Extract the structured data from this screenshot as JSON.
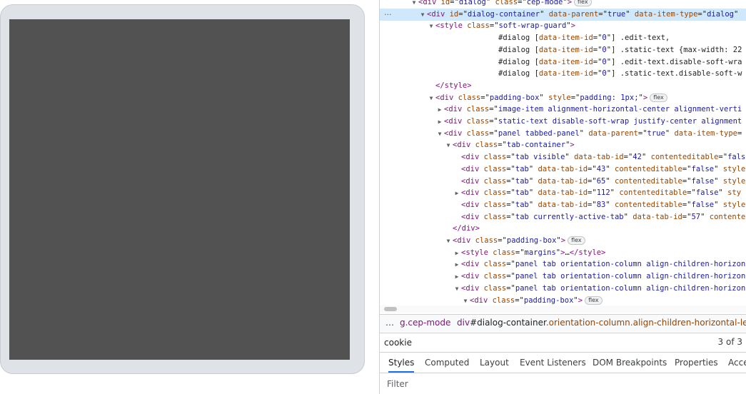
{
  "dom": {
    "rows": [
      {
        "indent": 2,
        "tri": "▼",
        "parts": [
          [
            "tag",
            "<div "
          ],
          [
            "an",
            "id"
          ],
          [
            "eq",
            "=\""
          ],
          [
            "av",
            "dialog"
          ],
          [
            "eq",
            "\" "
          ],
          [
            "an",
            "class"
          ],
          [
            "eq",
            "=\""
          ],
          [
            "av",
            "cep-mode"
          ],
          [
            "eq",
            "\""
          ],
          [
            "tag",
            ">"
          ]
        ],
        "badge": "flex",
        "selected": false
      },
      {
        "indent": 3,
        "tri": "▼",
        "parts": [
          [
            "tag",
            "<div "
          ],
          [
            "an",
            "id"
          ],
          [
            "eq",
            "=\""
          ],
          [
            "av",
            "dialog-container"
          ],
          [
            "eq",
            "\" "
          ],
          [
            "an",
            "data-parent"
          ],
          [
            "eq",
            "=\""
          ],
          [
            "av",
            "true"
          ],
          [
            "eq",
            "\" "
          ],
          [
            "an",
            "data-item-type"
          ],
          [
            "eq",
            "=\""
          ],
          [
            "av",
            "dialog"
          ],
          [
            "eq",
            "\""
          ]
        ],
        "selected": true
      },
      {
        "indent": 4,
        "tri": "▼",
        "parts": [
          [
            "tag",
            "<style "
          ],
          [
            "an",
            "class"
          ],
          [
            "eq",
            "=\""
          ],
          [
            "av",
            "soft-wrap-guard"
          ],
          [
            "eq",
            "\""
          ],
          [
            "tag",
            ">"
          ]
        ]
      },
      {
        "indent": 0,
        "pad": 154,
        "parts": [
          [
            "tx",
            "#dialog ["
          ],
          [
            "an",
            "data-item-id"
          ],
          [
            "eq",
            "=\""
          ],
          [
            "av",
            "0"
          ],
          [
            "eq",
            "\"] "
          ],
          [
            "tx",
            ".edit-text,"
          ]
        ]
      },
      {
        "indent": 0,
        "pad": 154,
        "parts": [
          [
            "tx",
            "#dialog ["
          ],
          [
            "an",
            "data-item-id"
          ],
          [
            "eq",
            "=\""
          ],
          [
            "av",
            "0"
          ],
          [
            "eq",
            "\"] "
          ],
          [
            "tx",
            ".static-text {max-width: 22"
          ]
        ]
      },
      {
        "indent": 0,
        "pad": 154,
        "parts": [
          [
            "tx",
            "#dialog ["
          ],
          [
            "an",
            "data-item-id"
          ],
          [
            "eq",
            "=\""
          ],
          [
            "av",
            "0"
          ],
          [
            "eq",
            "\"] "
          ],
          [
            "tx",
            ".edit-text.disable-soft-wra"
          ]
        ]
      },
      {
        "indent": 0,
        "pad": 154,
        "parts": [
          [
            "tx",
            "#dialog ["
          ],
          [
            "an",
            "data-item-id"
          ],
          [
            "eq",
            "=\""
          ],
          [
            "av",
            "0"
          ],
          [
            "eq",
            "\"] "
          ],
          [
            "tx",
            ".static-text.disable-soft-w"
          ]
        ]
      },
      {
        "indent": 4,
        "parts": [
          [
            "tag",
            "</style>"
          ]
        ]
      },
      {
        "indent": 4,
        "tri": "▼",
        "parts": [
          [
            "tag",
            "<div "
          ],
          [
            "an",
            "class"
          ],
          [
            "eq",
            "=\""
          ],
          [
            "av",
            "padding-box"
          ],
          [
            "eq",
            "\" "
          ],
          [
            "an",
            "style"
          ],
          [
            "eq",
            "=\""
          ],
          [
            "av",
            "padding: 1px;"
          ],
          [
            "eq",
            "\""
          ],
          [
            "tag",
            ">"
          ]
        ],
        "badge": "flex"
      },
      {
        "indent": 5,
        "tri": "▶",
        "parts": [
          [
            "tag",
            "<div "
          ],
          [
            "an",
            "class"
          ],
          [
            "eq",
            "=\""
          ],
          [
            "av",
            "image-item alignment-horizontal-center alignment-verti"
          ]
        ]
      },
      {
        "indent": 5,
        "tri": "▶",
        "parts": [
          [
            "tag",
            "<div "
          ],
          [
            "an",
            "class"
          ],
          [
            "eq",
            "=\""
          ],
          [
            "av",
            "static-text disable-soft-wrap justify-center alignment"
          ]
        ]
      },
      {
        "indent": 5,
        "tri": "▼",
        "parts": [
          [
            "tag",
            "<div "
          ],
          [
            "an",
            "class"
          ],
          [
            "eq",
            "=\""
          ],
          [
            "av",
            "panel tabbed-panel"
          ],
          [
            "eq",
            "\" "
          ],
          [
            "an",
            "data-parent"
          ],
          [
            "eq",
            "=\""
          ],
          [
            "av",
            "true"
          ],
          [
            "eq",
            "\" "
          ],
          [
            "an",
            "data-item-type"
          ],
          [
            "eq",
            "="
          ]
        ]
      },
      {
        "indent": 6,
        "tri": "▼",
        "parts": [
          [
            "tag",
            "<div "
          ],
          [
            "an",
            "class"
          ],
          [
            "eq",
            "=\""
          ],
          [
            "av",
            "tab-container"
          ],
          [
            "eq",
            "\""
          ],
          [
            "tag",
            ">"
          ]
        ]
      },
      {
        "indent": 7,
        "parts": [
          [
            "tag",
            "<div "
          ],
          [
            "an",
            "class"
          ],
          [
            "eq",
            "=\""
          ],
          [
            "av",
            "tab visible"
          ],
          [
            "eq",
            "\" "
          ],
          [
            "an",
            "data-tab-id"
          ],
          [
            "eq",
            "=\""
          ],
          [
            "av",
            "42"
          ],
          [
            "eq",
            "\" "
          ],
          [
            "an",
            "contenteditable"
          ],
          [
            "eq",
            "=\""
          ],
          [
            "av",
            "fals"
          ]
        ]
      },
      {
        "indent": 7,
        "parts": [
          [
            "tag",
            "<div "
          ],
          [
            "an",
            "class"
          ],
          [
            "eq",
            "=\""
          ],
          [
            "av",
            "tab"
          ],
          [
            "eq",
            "\" "
          ],
          [
            "an",
            "data-tab-id"
          ],
          [
            "eq",
            "=\""
          ],
          [
            "av",
            "43"
          ],
          [
            "eq",
            "\" "
          ],
          [
            "an",
            "contenteditable"
          ],
          [
            "eq",
            "=\""
          ],
          [
            "av",
            "false"
          ],
          [
            "eq",
            "\" "
          ],
          [
            "an",
            "style"
          ]
        ]
      },
      {
        "indent": 7,
        "parts": [
          [
            "tag",
            "<div "
          ],
          [
            "an",
            "class"
          ],
          [
            "eq",
            "=\""
          ],
          [
            "av",
            "tab"
          ],
          [
            "eq",
            "\" "
          ],
          [
            "an",
            "data-tab-id"
          ],
          [
            "eq",
            "=\""
          ],
          [
            "av",
            "65"
          ],
          [
            "eq",
            "\" "
          ],
          [
            "an",
            "contenteditable"
          ],
          [
            "eq",
            "=\""
          ],
          [
            "av",
            "false"
          ],
          [
            "eq",
            "\" "
          ],
          [
            "an",
            "style"
          ]
        ]
      },
      {
        "indent": 6,
        "tri": "▶",
        "extra": 12,
        "parts": [
          [
            "tag",
            "<div "
          ],
          [
            "an",
            "class"
          ],
          [
            "eq",
            "=\""
          ],
          [
            "av",
            "tab"
          ],
          [
            "eq",
            "\" "
          ],
          [
            "an",
            "data-tab-id"
          ],
          [
            "eq",
            "=\""
          ],
          [
            "av",
            "112"
          ],
          [
            "eq",
            "\" "
          ],
          [
            "an",
            "contenteditable"
          ],
          [
            "eq",
            "=\""
          ],
          [
            "av",
            "false"
          ],
          [
            "eq",
            "\" "
          ],
          [
            "an",
            "sty"
          ]
        ]
      },
      {
        "indent": 7,
        "parts": [
          [
            "tag",
            "<div "
          ],
          [
            "an",
            "class"
          ],
          [
            "eq",
            "=\""
          ],
          [
            "av",
            "tab"
          ],
          [
            "eq",
            "\" "
          ],
          [
            "an",
            "data-tab-id"
          ],
          [
            "eq",
            "=\""
          ],
          [
            "av",
            "83"
          ],
          [
            "eq",
            "\" "
          ],
          [
            "an",
            "contenteditable"
          ],
          [
            "eq",
            "=\""
          ],
          [
            "av",
            "false"
          ],
          [
            "eq",
            "\" "
          ],
          [
            "an",
            "style"
          ]
        ]
      },
      {
        "indent": 7,
        "parts": [
          [
            "tag",
            "<div "
          ],
          [
            "an",
            "class"
          ],
          [
            "eq",
            "=\""
          ],
          [
            "av",
            "tab currently-active-tab"
          ],
          [
            "eq",
            "\" "
          ],
          [
            "an",
            "data-tab-id"
          ],
          [
            "eq",
            "=\""
          ],
          [
            "av",
            "57"
          ],
          [
            "eq",
            "\" "
          ],
          [
            "an",
            "contente"
          ]
        ]
      },
      {
        "indent": 6,
        "parts": [
          [
            "tag",
            "</div>"
          ]
        ]
      },
      {
        "indent": 6,
        "tri": "▼",
        "parts": [
          [
            "tag",
            "<div "
          ],
          [
            "an",
            "class"
          ],
          [
            "eq",
            "=\""
          ],
          [
            "av",
            "padding-box"
          ],
          [
            "eq",
            "\""
          ],
          [
            "tag",
            ">"
          ]
        ],
        "badge": "flex"
      },
      {
        "indent": 7,
        "tri": "▶",
        "parts": [
          [
            "tag",
            "<style "
          ],
          [
            "an",
            "class"
          ],
          [
            "eq",
            "=\""
          ],
          [
            "av",
            "margins"
          ],
          [
            "eq",
            "\""
          ],
          [
            "tag",
            ">"
          ],
          [
            "tx",
            "…"
          ],
          [
            "tag",
            "</style>"
          ]
        ]
      },
      {
        "indent": 7,
        "tri": "▶",
        "parts": [
          [
            "tag",
            "<div "
          ],
          [
            "an",
            "class"
          ],
          [
            "eq",
            "=\""
          ],
          [
            "av",
            "panel tab orientation-column align-children-horizon"
          ]
        ]
      },
      {
        "indent": 7,
        "tri": "▶",
        "parts": [
          [
            "tag",
            "<div "
          ],
          [
            "an",
            "class"
          ],
          [
            "eq",
            "=\""
          ],
          [
            "av",
            "panel tab orientation-column align-children-horizon"
          ]
        ]
      },
      {
        "indent": 7,
        "tri": "▼",
        "parts": [
          [
            "tag",
            "<div "
          ],
          [
            "an",
            "class"
          ],
          [
            "eq",
            "=\""
          ],
          [
            "av",
            "panel tab orientation-column align-children-horizon"
          ]
        ]
      },
      {
        "indent": 8,
        "tri": "▼",
        "parts": [
          [
            "tag",
            "<div "
          ],
          [
            "an",
            "class"
          ],
          [
            "eq",
            "=\""
          ],
          [
            "av",
            "padding-box"
          ],
          [
            "eq",
            "\""
          ],
          [
            "tag",
            ">"
          ]
        ],
        "badge": "flex"
      }
    ]
  },
  "breadcrumb": {
    "more": "…",
    "item1": "g.cep-mode",
    "item2_tag": "div",
    "item2_id": "#dialog-container",
    "item2_classes": ".orientation-column.align-children-horizontal-left.align-c"
  },
  "search": {
    "value": "cookie",
    "count": "3 of 3"
  },
  "tabs": [
    "Styles",
    "Computed",
    "Layout",
    "Event Listeners",
    "DOM Breakpoints",
    "Properties",
    "Acce"
  ],
  "active_tab": "Styles",
  "filter": {
    "placeholder": "Filter"
  },
  "gutter_marker": "···"
}
